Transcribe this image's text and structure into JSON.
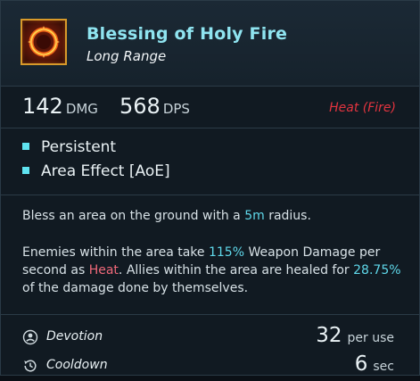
{
  "skill": {
    "name": "Blessing of Holy Fire",
    "range": "Long Range",
    "icon": "holy-fire-ring-icon"
  },
  "stats": {
    "damage_value": "142",
    "damage_unit": "DMG",
    "dps_value": "568",
    "dps_unit": "DPS",
    "element": "Heat (Fire)"
  },
  "tags": [
    "Persistent",
    "Area Effect [AoE]"
  ],
  "description": {
    "p1_a": "Bless an area on the ground with a ",
    "p1_radius": "5m",
    "p1_b": " radius.",
    "p2_a": "Enemies within the area take ",
    "p2_pct": "115%",
    "p2_b": " Weapon Damage per second as ",
    "p2_heat": "Heat",
    "p2_c": ". Allies within the area are healed for ",
    "p2_heal": "28.75%",
    "p2_d": " of the damage done by themselves."
  },
  "costs": {
    "devotion_label": "Devotion",
    "devotion_value": "32",
    "devotion_unit": "per use",
    "cooldown_label": "Cooldown",
    "cooldown_value": "6",
    "cooldown_unit": "sec"
  },
  "colors": {
    "title": "#8fe4f0",
    "highlight": "#5fd8ea",
    "heat": "#f0697a",
    "element": "#e2343f",
    "bullet": "#5fe3f0",
    "icon_border": "#d89a2a"
  }
}
